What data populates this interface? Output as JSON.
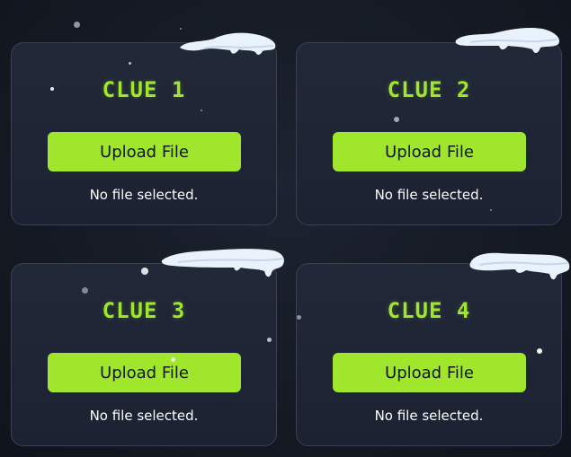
{
  "clues": [
    {
      "title": "CLUE 1",
      "button_label": "Upload File",
      "status": "No file selected."
    },
    {
      "title": "CLUE 2",
      "button_label": "Upload File",
      "status": "No file selected."
    },
    {
      "title": "CLUE 3",
      "button_label": "Upload File",
      "status": "No file selected."
    },
    {
      "title": "CLUE 4",
      "button_label": "Upload File",
      "status": "No file selected."
    }
  ],
  "colors": {
    "accent": "#9fe62c",
    "card_background": "#1f2534",
    "page_background": "#151a24",
    "text": "#ffffff",
    "button_text": "#12161f"
  },
  "decorations": {
    "snow_cap_icon": "snow-cap-icon",
    "snowflake_icon": "snowflake-icon"
  }
}
